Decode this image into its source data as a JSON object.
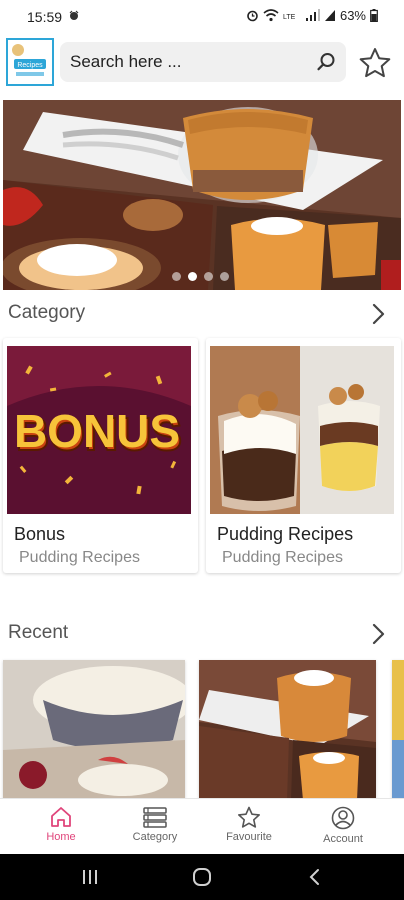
{
  "status_bar": {
    "time": "15:59",
    "battery": "63%"
  },
  "header": {
    "logo_text": "Recipes",
    "search_placeholder": "Search here ...",
    "search_icon": "search-icon",
    "favourite_icon": "star-icon"
  },
  "banner": {
    "dots_total": 4,
    "dot_active_index": 1
  },
  "category_section": {
    "title": "Category",
    "items": [
      {
        "name": "Bonus",
        "subtitle": "Pudding Recipes",
        "image_text": "BONUS"
      },
      {
        "name": "Pudding Recipes",
        "subtitle": "Pudding Recipes"
      }
    ]
  },
  "recent_section": {
    "title": "Recent"
  },
  "bottom_nav": {
    "items": [
      {
        "label": "Home",
        "icon": "home-icon",
        "active": true
      },
      {
        "label": "Category",
        "icon": "list-icon",
        "active": false
      },
      {
        "label": "Favourite",
        "icon": "star-icon",
        "active": false
      },
      {
        "label": "Account",
        "icon": "account-icon",
        "active": false
      }
    ],
    "active_color": "#e0457b"
  },
  "system_nav": {
    "buttons": [
      "recents-icon",
      "home-circle-icon",
      "back-icon"
    ]
  }
}
